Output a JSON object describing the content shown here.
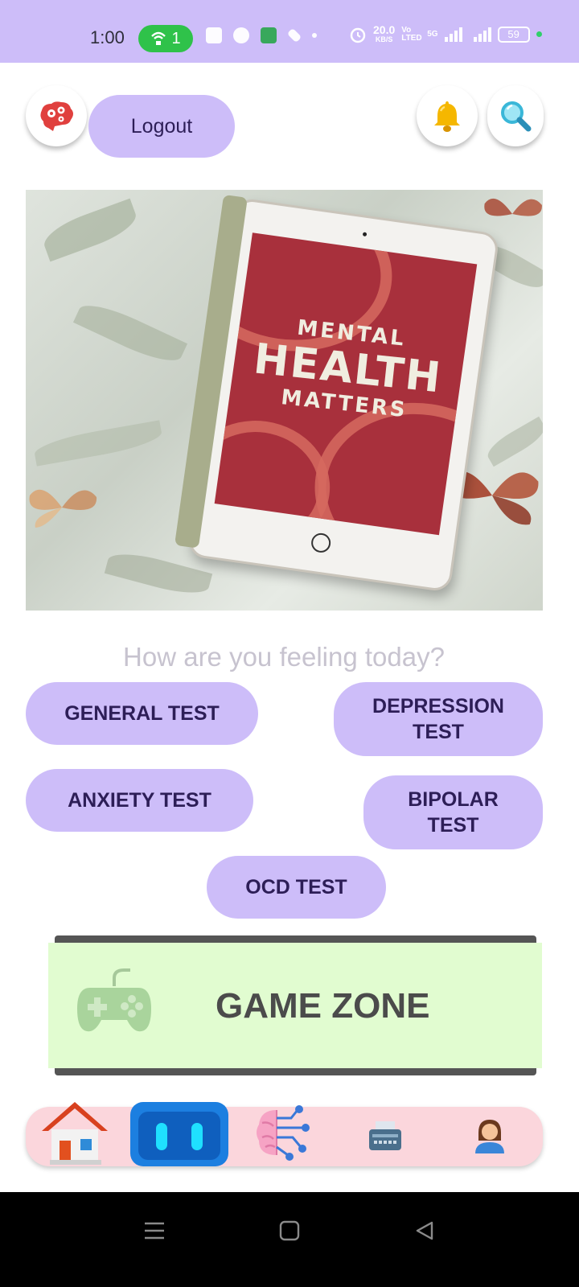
{
  "status_bar": {
    "time": "1:00",
    "hotspot_count": "1",
    "net_speed_value": "20.0",
    "net_speed_unit": "KB/S",
    "volte": "Vo LTED",
    "network": "5G",
    "battery": "59"
  },
  "header": {
    "logout_label": "Logout"
  },
  "hero": {
    "screen_line1": "MENTAL",
    "screen_line2": "HEALTH",
    "screen_line3": "MATTERS"
  },
  "main": {
    "question": "How are you feeling today?",
    "tests": {
      "general": "GENERAL TEST",
      "depression": "DEPRESSION TEST",
      "anxiety": "ANXIETY TEST",
      "bipolar": "BIPOLAR TEST",
      "ocd": "OCD TEST"
    },
    "game_zone_label": "GAME ZONE"
  },
  "colors": {
    "accent": "#cdbdf9",
    "button_text": "#2d1e57",
    "game_zone_bg": "#e1fcd0",
    "nav_bg": "#fbd6dc"
  },
  "icons": {
    "brain": "brain-gears-icon",
    "bell": "bell-icon",
    "search": "search-icon",
    "gamepad": "gamepad-icon",
    "home": "home-icon",
    "robot": "robot-icon",
    "ai_brain": "ai-brain-icon",
    "typewriter": "typewriter-icon",
    "profile": "profile-icon"
  }
}
